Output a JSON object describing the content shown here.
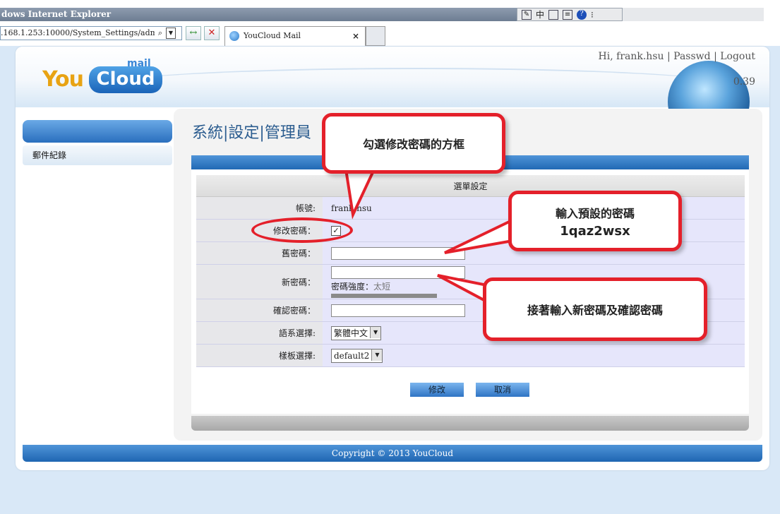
{
  "browser": {
    "title": "dows Internet Explorer",
    "address": ".168.1.253:10000/System_Settings/admin.cgi",
    "tab_title": "YouCloud Mail",
    "tab_close": "×",
    "back_forward_glyph": "↔",
    "stop_glyph": "✕",
    "search_glyph": "⌕",
    "dropdown_glyph": "▼",
    "toolbar_glyphs": [
      "中",
      "?"
    ]
  },
  "header": {
    "logo_you": "You",
    "logo_cloud": "Cloud",
    "logo_mail": "mail",
    "greeting": "Hi, frank.hsu",
    "passwd_link": "Passwd",
    "logout_link": "Logout",
    "separator": "|",
    "globe_number": "0.39"
  },
  "sidebar": {
    "items": [
      {
        "label": "郵件紀錄"
      }
    ]
  },
  "page": {
    "title": "系統|設定|管理員",
    "section_caption": "選單設定"
  },
  "form": {
    "account_label": "帳號:",
    "account_value": "frank.hsu",
    "change_pw_label": "修改密碼：",
    "change_pw_checked": true,
    "checkbox_mark": "✓",
    "old_pw_label": "舊密碼：",
    "new_pw_label": "新密碼：",
    "strength_label": "密碼強度：",
    "strength_value": "太短",
    "confirm_pw_label": "確認密碼：",
    "language_label": "語系選擇:",
    "language_value": "繁體中文",
    "template_label": "樣板選擇:",
    "template_value": "default2",
    "submit_label": "修改",
    "cancel_label": "取消"
  },
  "footer": {
    "copyright": "Copyright © 2013 YouCloud"
  },
  "annotations": {
    "bubble_checkbox": "勾選修改密碼的方框",
    "bubble_default_title": "輸入預設的密碼",
    "bubble_default_value": "1qaz2wsx",
    "bubble_new": "接著輸入新密碼及確認密碼"
  },
  "colors": {
    "accent_blue": "#2a6fbe",
    "annotation_red": "#e4202a",
    "title_blue": "#2b5c8f"
  }
}
